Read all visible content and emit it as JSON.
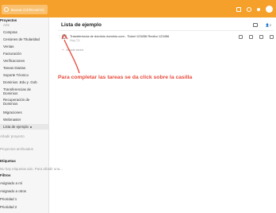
{
  "topbar": {
    "search_placeholder": "Buscar (Ctrl/Cmd+K)",
    "icons": [
      "search-icon",
      "add-icon",
      "sync-icon",
      "notifications-icon",
      "avatar"
    ]
  },
  "sidebar": {
    "items": [
      {
        "label": "Proyectos",
        "style": "bold"
      },
      {
        "label": "Arte",
        "style": "muted"
      },
      {
        "label": "Compras"
      },
      {
        "label": "Cesiones de Titularidad"
      },
      {
        "label": "Ventas"
      },
      {
        "label": "Facturación"
      },
      {
        "label": "Verificaciones"
      },
      {
        "label": "Tareas Diarias"
      },
      {
        "label": "Soporte Técnico"
      },
      {
        "label": "Dominios .Edu y .Gob"
      },
      {
        "label": "Transferencias de Dominios"
      },
      {
        "label": "Recuperación de Dominios"
      },
      {
        "label": "Migraciones"
      },
      {
        "label": "Webmaster"
      },
      {
        "label": "Lista de ejemplo",
        "style": "active"
      },
      {
        "label": "Añadir proyecto",
        "style": "muted"
      },
      {
        "label": "Proyectos archivados",
        "style": "muted"
      },
      {
        "label": "Etiquetas",
        "style": "bold"
      },
      {
        "label": "No hay etiquetas aún. Para añadir una...",
        "style": "muted"
      },
      {
        "label": "Filtros",
        "style": "bold"
      },
      {
        "label": "Asignado a mí"
      },
      {
        "label": "Asignado a otros"
      },
      {
        "label": "Prioridad 1"
      },
      {
        "label": "Prioridad 2"
      }
    ]
  },
  "main": {
    "title": "Lista de ejemplo",
    "header_icons": [
      "comment-icon",
      "share-icon"
    ],
    "header_user_count": "2",
    "task": {
      "text": "Transferencia de dominio dominio.com - Ticket 123456 Recibo 123456",
      "meta": "Hoy",
      "sub_count": "1"
    },
    "add_task_label": "Añadir tarea"
  },
  "annotation": {
    "text": "Para completar las tareas se da click sobre la casilla",
    "color": "#e8493a"
  },
  "colors": {
    "topbar": "#f5a02a",
    "accent_red": "#e8493a"
  }
}
